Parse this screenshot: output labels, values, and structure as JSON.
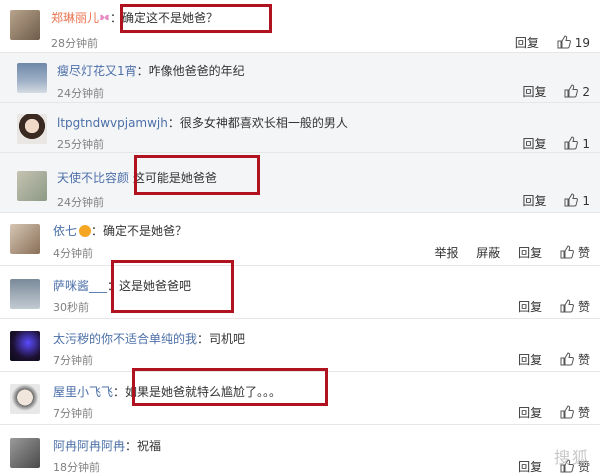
{
  "comments": [
    {
      "name": "郑琳丽儿",
      "sep": "：",
      "text": "确定这不是她爸？",
      "time": "28分钟前",
      "actions": [
        "回复"
      ],
      "likes": "19"
    },
    {
      "name": "瘦尽灯花又1宵",
      "sep": "：",
      "text": "咋像他爸爸的年纪",
      "time": "24分钟前",
      "actions": [
        "回复"
      ],
      "likes": "2"
    },
    {
      "name": "ltpgtndwvpjamwjh",
      "sep": "：",
      "text": "很多女神都喜欢长相一般的男人",
      "time": "25分钟前",
      "actions": [
        "回复"
      ],
      "likes": "1"
    },
    {
      "name": "天使不比容颜",
      "sep": "：",
      "text": "这可能是她爸爸",
      "time": "24分钟前",
      "actions": [
        "回复"
      ],
      "likes": "1"
    },
    {
      "name": "依七",
      "sep": "：",
      "text": "确定不是她爸？",
      "time": "4分钟前",
      "actions": [
        "举报",
        "屏蔽",
        "回复"
      ],
      "likes": "赞"
    },
    {
      "name": "萨咪酱___",
      "sep": "：",
      "text": "这是她爸爸吧",
      "time": "30秒前",
      "actions": [
        "回复"
      ],
      "likes": "赞"
    },
    {
      "name": "太污秽的你不适合单纯的我",
      "sep": "：",
      "text": "司机吧",
      "time": "7分钟前",
      "actions": [
        "回复"
      ],
      "likes": "赞"
    },
    {
      "name": "屋里小飞飞",
      "sep": "：",
      "text": "如果是她爸就特么尴尬了。。。",
      "time": "7分钟前",
      "actions": [
        "回复"
      ],
      "likes": "赞"
    },
    {
      "name": "阿冉阿冉阿冉",
      "sep": "：",
      "text": "祝福",
      "time": "18分钟前",
      "actions": [
        "回复"
      ],
      "likes": "赞"
    }
  ],
  "watermark": "搜狐",
  "colors": {
    "highlight": "#b0131f",
    "name_orange": "#eb7350",
    "name_blue": "#4c6fa8",
    "sub_bg": "#f4f5f7"
  }
}
